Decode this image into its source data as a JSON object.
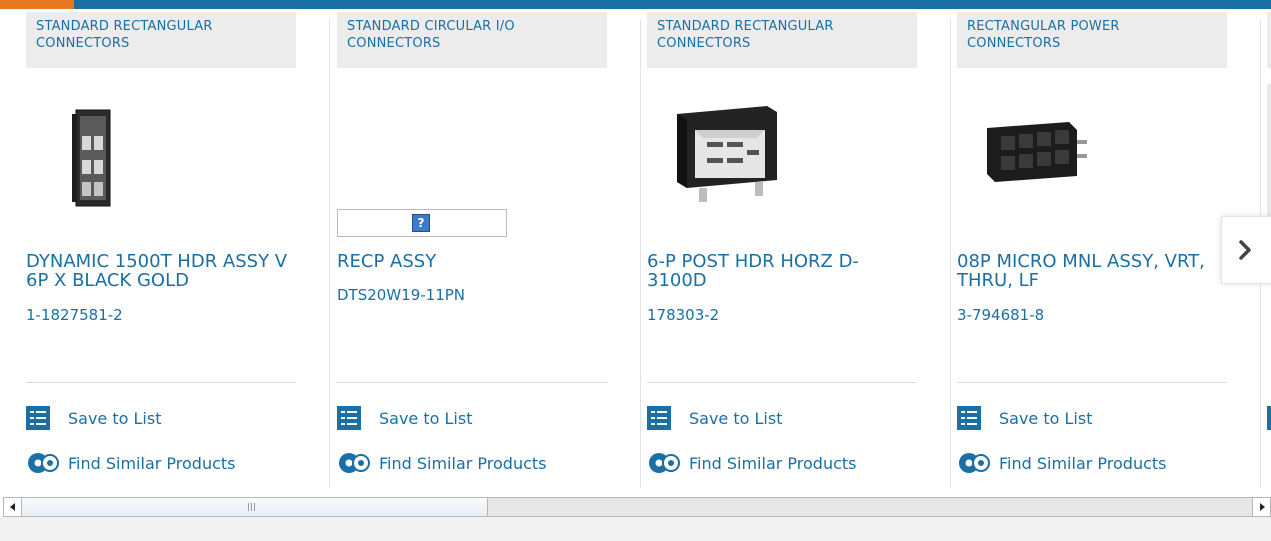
{
  "colors": {
    "brand_blue": "#1a6fa5",
    "accent_orange": "#e87722",
    "category_bg": "#ececec"
  },
  "products": [
    {
      "category": "STANDARD RECTANGULAR CONNECTORS",
      "title": "DYNAMIC 1500T HDR ASSY V 6P X BLACK GOLD",
      "part_number": "1-1827581-2",
      "image": "vertical-header-connector",
      "save_label": "Save to List",
      "similar_label": "Find Similar Products"
    },
    {
      "category": "STANDARD CIRCULAR I/O CONNECTORS",
      "title": "RECP ASSY",
      "part_number": "DTS20W19-11PN",
      "image": "broken-image-placeholder",
      "save_label": "Save to List",
      "similar_label": "Find Similar Products"
    },
    {
      "category": "STANDARD RECTANGULAR CONNECTORS",
      "title": "6-P POST HDR HORZ D-3100D",
      "part_number": "178303-2",
      "image": "horizontal-post-header",
      "save_label": "Save to List",
      "similar_label": "Find Similar Products"
    },
    {
      "category": "RECTANGULAR POWER CONNECTORS",
      "title": "08P MICRO MNL ASSY, VRT, THRU, LF",
      "part_number": "3-794681-8",
      "image": "micro-mate-n-lok-header",
      "save_label": "Save to List",
      "similar_label": "Find Similar Products"
    }
  ],
  "navigation": {
    "next_icon": "chevron-right-icon"
  },
  "scrollbar": {
    "left_arrow": "arrow-left-icon",
    "right_arrow": "arrow-right-icon"
  }
}
